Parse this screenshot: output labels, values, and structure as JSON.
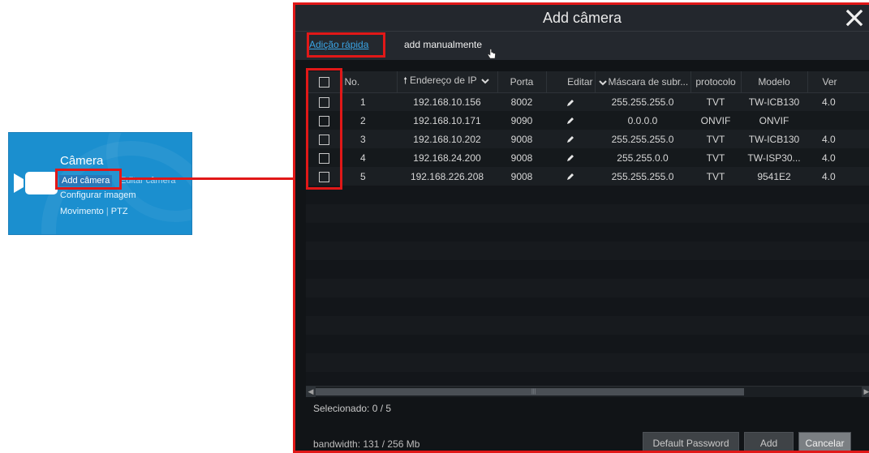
{
  "tile": {
    "title": "Câmera",
    "links": {
      "add": "Add câmera",
      "edit": "Editar câmera",
      "image": "Configurar imagem",
      "motion": "Movimento",
      "separator": "|",
      "ptz": "PTZ"
    },
    "icon": "video-camera-icon"
  },
  "dialog": {
    "title": "Add câmera",
    "tabs": {
      "quick": "Adição rápida",
      "manual": "add manualmente"
    },
    "columns": [
      "No.",
      "Endereço de IP",
      "Porta",
      "Editar",
      "Máscara de subr...",
      "protocolo",
      "Modelo",
      "Ver"
    ],
    "rows": [
      {
        "no": "1",
        "ip": "192.168.10.156",
        "port": "8002",
        "mask": "255.255.255.0",
        "protocol": "TVT",
        "model": "TW-ICB130",
        "ver": "4.0"
      },
      {
        "no": "2",
        "ip": "192.168.10.171",
        "port": "9090",
        "mask": "0.0.0.0",
        "protocol": "ONVIF",
        "model": "ONVIF",
        "ver": ""
      },
      {
        "no": "3",
        "ip": "192.168.10.202",
        "port": "9008",
        "mask": "255.255.255.0",
        "protocol": "TVT",
        "model": "TW-ICB130",
        "ver": "4.0"
      },
      {
        "no": "4",
        "ip": "192.168.24.200",
        "port": "9008",
        "mask": "255.255.0.0",
        "protocol": "TVT",
        "model": "TW-ISP30...",
        "ver": "4.0"
      },
      {
        "no": "5",
        "ip": "192.168.226.208",
        "port": "9008",
        "mask": "255.255.255.0",
        "protocol": "TVT",
        "model": "9541E2",
        "ver": "4.0"
      }
    ],
    "selected": "Selecionado: 0 / 5",
    "bandwidth": "bandwidth: 131 / 256 Mb",
    "buttons": {
      "default_password": "Default Password",
      "add": "Add",
      "cancel": "Cancelar"
    }
  },
  "colors": {
    "highlight": "#e11818",
    "tile_blue": "#1b8fcf",
    "tab_active": "#3aa5e6"
  }
}
